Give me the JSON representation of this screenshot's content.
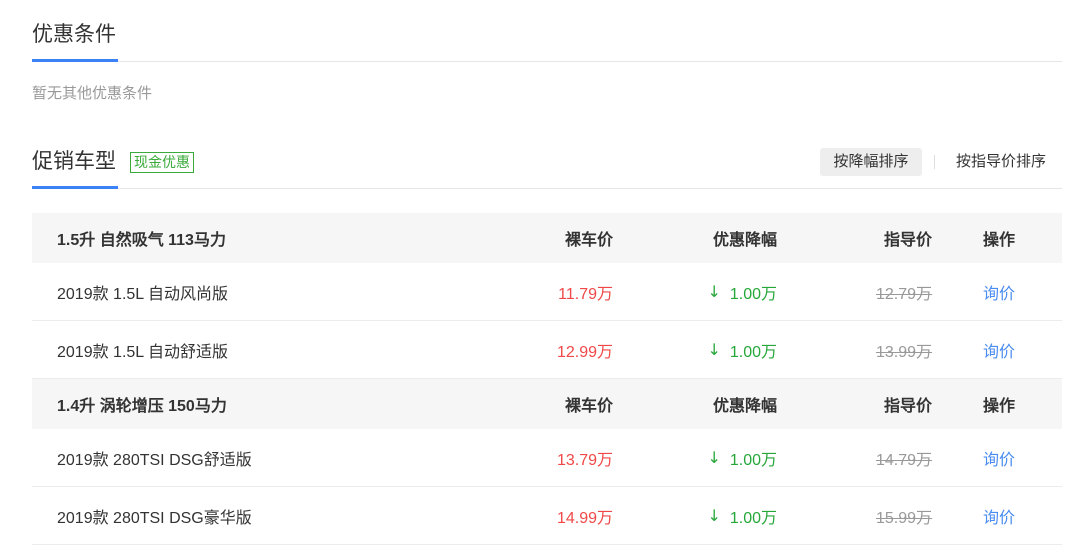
{
  "conditions": {
    "title": "优惠条件",
    "empty_text": "暂无其他优惠条件"
  },
  "promo": {
    "title": "促销车型",
    "badge": "现金优惠",
    "sort": [
      {
        "label": "按降幅排序",
        "active": true
      },
      {
        "label": "按指导价排序",
        "active": false
      }
    ]
  },
  "table": {
    "columns": {
      "price": "裸车价",
      "discount": "优惠降幅",
      "guide": "指导价",
      "action": "操作"
    },
    "groups": [
      {
        "title": "1.5升 自然吸气 113马力",
        "rows": [
          {
            "name": "2019款 1.5L 自动风尚版",
            "price": "11.79万",
            "discount_icon": "arrow-down-icon",
            "discount": "1.00万",
            "guide": "12.79万",
            "action": "询价"
          },
          {
            "name": "2019款 1.5L 自动舒适版",
            "price": "12.99万",
            "discount_icon": "arrow-down-icon",
            "discount": "1.00万",
            "guide": "13.99万",
            "action": "询价"
          }
        ]
      },
      {
        "title": "1.4升 涡轮增压 150马力",
        "rows": [
          {
            "name": "2019款 280TSI DSG舒适版",
            "price": "13.79万",
            "discount_icon": "arrow-down-icon",
            "discount": "1.00万",
            "guide": "14.79万",
            "action": "询价"
          },
          {
            "name": "2019款 280TSI DSG豪华版",
            "price": "14.99万",
            "discount_icon": "arrow-down-icon",
            "discount": "1.00万",
            "guide": "15.99万",
            "action": "询价"
          }
        ]
      }
    ]
  },
  "colors": {
    "accent": "#3b82f6",
    "price_red": "#f04848",
    "discount_green": "#26a73a",
    "link_blue": "#4a8cf0",
    "badge_green": "#3aab3a"
  }
}
